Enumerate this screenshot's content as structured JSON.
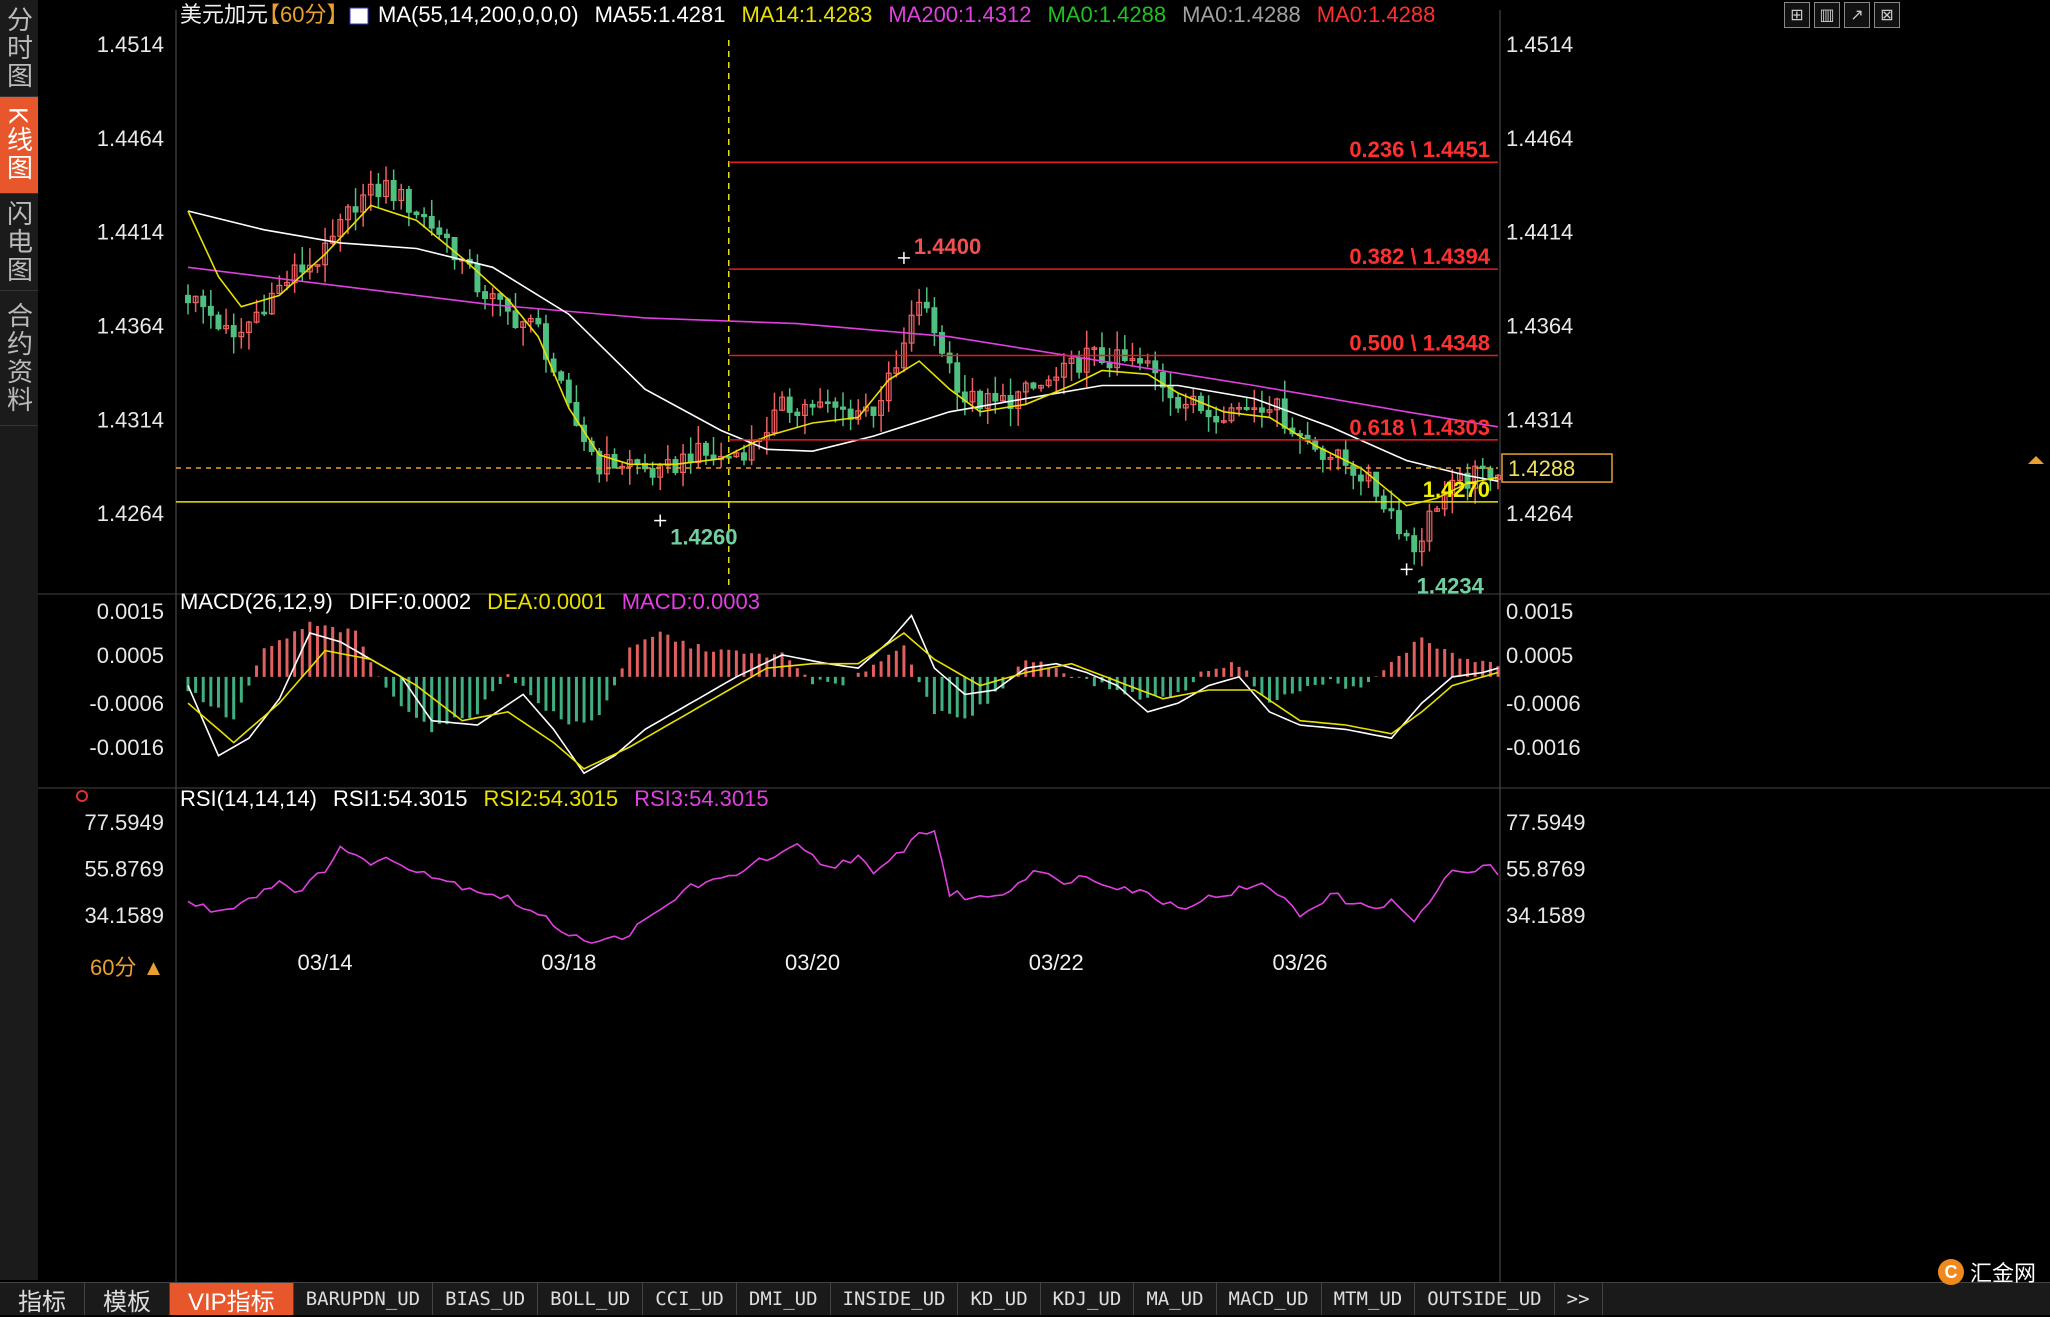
{
  "window": {
    "sidebar_tabs": [
      "分时图",
      "K线图",
      "闪电图",
      "合约资料"
    ],
    "active_sidebar_tab": 1,
    "period_label": "60分 ▲",
    "brand": "汇金网",
    "toolbar_icons": [
      "grid-icon",
      "layout-icon",
      "line-chart-icon",
      "close-icon"
    ]
  },
  "indicator_tabs": {
    "main": [
      "指标",
      "模板",
      "VIP指标"
    ],
    "active": 2,
    "list": [
      "BARUPDN_UD",
      "BIAS_UD",
      "BOLL_UD",
      "CCI_UD",
      "DMI_UD",
      "INSIDE_UD",
      "KD_UD",
      "KDJ_UD",
      "MA_UD",
      "MACD_UD",
      "MTM_UD",
      "OUTSIDE_UD",
      ">>"
    ]
  },
  "chart_data": [
    {
      "type": "candlestick",
      "title": "美元加元",
      "period": "【60分】",
      "legend": [
        {
          "text": "MA(55,14,200,0,0,0)",
          "color": "#ffffff"
        },
        {
          "text": "MA55:1.4281",
          "color": "#ffffff"
        },
        {
          "text": "MA14:1.4283",
          "color": "#e8e000"
        },
        {
          "text": "MA200:1.4312",
          "color": "#e040e0"
        },
        {
          "text": "MA0:1.4288",
          "color": "#20c020"
        },
        {
          "text": "MA0:1.4288",
          "color": "#a0a0a0"
        },
        {
          "text": "MA0:1.4288",
          "color": "#ff3030"
        }
      ],
      "y_ticks": [
        "1.4514",
        "1.4464",
        "1.4414",
        "1.4364",
        "1.4314",
        "1.4264"
      ],
      "ylim": [
        1.4223,
        1.453
      ],
      "x_ticks": [
        {
          "label": "03/14",
          "x": 18
        },
        {
          "label": "03/18",
          "x": 50
        },
        {
          "label": "03/20",
          "x": 82
        },
        {
          "label": "03/22",
          "x": 114
        },
        {
          "label": "03/26",
          "x": 146
        }
      ],
      "x_range": [
        0,
        172
      ],
      "close_anchors": [
        [
          0,
          1.438
        ],
        [
          3,
          1.437
        ],
        [
          6,
          1.4355
        ],
        [
          10,
          1.4376
        ],
        [
          14,
          1.4392
        ],
        [
          18,
          1.4402
        ],
        [
          22,
          1.443
        ],
        [
          26,
          1.4438
        ],
        [
          30,
          1.4425
        ],
        [
          34,
          1.441
        ],
        [
          38,
          1.4385
        ],
        [
          42,
          1.437
        ],
        [
          46,
          1.4362
        ],
        [
          50,
          1.4318
        ],
        [
          54,
          1.429
        ],
        [
          58,
          1.4291
        ],
        [
          62,
          1.4284
        ],
        [
          66,
          1.4296
        ],
        [
          70,
          1.4293
        ],
        [
          74,
          1.43
        ],
        [
          78,
          1.432
        ],
        [
          82,
          1.4322
        ],
        [
          86,
          1.4318
        ],
        [
          90,
          1.432
        ],
        [
          93,
          1.434
        ],
        [
          96,
          1.4378
        ],
        [
          99,
          1.4352
        ],
        [
          102,
          1.4325
        ],
        [
          106,
          1.4322
        ],
        [
          110,
          1.4328
        ],
        [
          114,
          1.4335
        ],
        [
          118,
          1.4348
        ],
        [
          122,
          1.4345
        ],
        [
          126,
          1.4342
        ],
        [
          130,
          1.4325
        ],
        [
          134,
          1.4318
        ],
        [
          138,
          1.432
        ],
        [
          142,
          1.4324
        ],
        [
          146,
          1.4305
        ],
        [
          150,
          1.4295
        ],
        [
          154,
          1.4285
        ],
        [
          158,
          1.4265
        ],
        [
          161,
          1.4245
        ],
        [
          164,
          1.427
        ],
        [
          167,
          1.428
        ],
        [
          170,
          1.4285
        ],
        [
          172,
          1.4288
        ]
      ],
      "fib_levels": [
        {
          "label": "0.236 \\ 1.4451",
          "value": 1.4451
        },
        {
          "label": "0.382 \\ 1.4394",
          "value": 1.4394
        },
        {
          "label": "0.500 \\ 1.4348",
          "value": 1.4348
        },
        {
          "label": "0.618 \\ 1.4303",
          "value": 1.4303
        }
      ],
      "fib_start_x": 71,
      "support_line": {
        "label": "1.4270",
        "value": 1.427
      },
      "current_price": {
        "label": "1.4288",
        "value": 1.4288
      },
      "vertical_marker_x": 71,
      "extreme_labels": [
        {
          "label": "1.4400",
          "x": 94,
          "value": 1.44,
          "type": "high"
        },
        {
          "label": "1.4260",
          "x": 62,
          "value": 1.426,
          "type": "low"
        },
        {
          "label": "1.4234",
          "x": 160,
          "value": 1.4234,
          "type": "low"
        }
      ],
      "ma_lines": [
        {
          "name": "MA200",
          "color": "#e040e0",
          "points": [
            [
              0,
              1.4395
            ],
            [
              20,
              1.4385
            ],
            [
              40,
              1.4375
            ],
            [
              60,
              1.4368
            ],
            [
              80,
              1.4365
            ],
            [
              100,
              1.4358
            ],
            [
              120,
              1.4345
            ],
            [
              140,
              1.4332
            ],
            [
              160,
              1.4318
            ],
            [
              172,
              1.431
            ]
          ]
        },
        {
          "name": "MA55",
          "color": "#ffffff",
          "points": [
            [
              0,
              1.4425
            ],
            [
              10,
              1.4415
            ],
            [
              20,
              1.4408
            ],
            [
              30,
              1.4405
            ],
            [
              40,
              1.4395
            ],
            [
              50,
              1.437
            ],
            [
              60,
              1.433
            ],
            [
              70,
              1.4308
            ],
            [
              76,
              1.4298
            ],
            [
              82,
              1.4297
            ],
            [
              90,
              1.4305
            ],
            [
              100,
              1.4318
            ],
            [
              110,
              1.4325
            ],
            [
              120,
              1.4332
            ],
            [
              130,
              1.4332
            ],
            [
              140,
              1.4325
            ],
            [
              150,
              1.431
            ],
            [
              160,
              1.4292
            ],
            [
              168,
              1.4284
            ],
            [
              172,
              1.4281
            ]
          ]
        },
        {
          "name": "MA14",
          "color": "#e8e000",
          "points": [
            [
              0,
              1.4425
            ],
            [
              4,
              1.439
            ],
            [
              7,
              1.4374
            ],
            [
              12,
              1.438
            ],
            [
              18,
              1.4402
            ],
            [
              24,
              1.4428
            ],
            [
              30,
              1.442
            ],
            [
              36,
              1.44
            ],
            [
              42,
              1.4378
            ],
            [
              46,
              1.4358
            ],
            [
              50,
              1.432
            ],
            [
              54,
              1.4295
            ],
            [
              58,
              1.429
            ],
            [
              64,
              1.429
            ],
            [
              70,
              1.4293
            ],
            [
              76,
              1.4305
            ],
            [
              82,
              1.4312
            ],
            [
              88,
              1.4315
            ],
            [
              92,
              1.4335
            ],
            [
              96,
              1.4345
            ],
            [
              100,
              1.433
            ],
            [
              104,
              1.4318
            ],
            [
              110,
              1.4322
            ],
            [
              116,
              1.4332
            ],
            [
              120,
              1.434
            ],
            [
              126,
              1.4338
            ],
            [
              130,
              1.4328
            ],
            [
              136,
              1.4318
            ],
            [
              142,
              1.4315
            ],
            [
              148,
              1.43
            ],
            [
              154,
              1.4288
            ],
            [
              160,
              1.4268
            ],
            [
              164,
              1.4272
            ],
            [
              168,
              1.428
            ],
            [
              172,
              1.4283
            ]
          ]
        }
      ]
    },
    {
      "type": "bar+line",
      "title": "MACD(26,12,9)",
      "legend": [
        {
          "text": "MACD(26,12,9)",
          "color": "#ffffff"
        },
        {
          "text": "DIFF:0.0002",
          "color": "#ffffff"
        },
        {
          "text": "DEA:0.0001",
          "color": "#e8e000"
        },
        {
          "text": "MACD:0.0003",
          "color": "#e040e0"
        }
      ],
      "y_ticks": [
        "0.0015",
        "0.0005",
        "-0.0006",
        "-0.0016"
      ],
      "ylim": [
        -0.0024,
        0.0018
      ],
      "hist_anchors": [
        [
          0,
          -0.0003
        ],
        [
          6,
          -0.001
        ],
        [
          10,
          0.0006
        ],
        [
          16,
          0.0012
        ],
        [
          22,
          0.001
        ],
        [
          26,
          -0.0003
        ],
        [
          32,
          -0.0012
        ],
        [
          38,
          -0.0008
        ],
        [
          42,
          0.0001
        ],
        [
          46,
          -0.0006
        ],
        [
          50,
          -0.0011
        ],
        [
          54,
          -0.0009
        ],
        [
          58,
          0.0006
        ],
        [
          62,
          0.001
        ],
        [
          66,
          0.0007
        ],
        [
          70,
          0.0006
        ],
        [
          74,
          0.0005
        ],
        [
          78,
          0.0005
        ],
        [
          82,
          -0.0001
        ],
        [
          86,
          -0.0002
        ],
        [
          90,
          0.0003
        ],
        [
          94,
          0.0007
        ],
        [
          98,
          -0.0008
        ],
        [
          102,
          -0.001
        ],
        [
          106,
          -0.0004
        ],
        [
          110,
          0.0004
        ],
        [
          114,
          0.0002
        ],
        [
          118,
          -0.0001
        ],
        [
          122,
          -0.0003
        ],
        [
          126,
          -0.0005
        ],
        [
          130,
          -0.0004
        ],
        [
          134,
          0.0002
        ],
        [
          138,
          0.0003
        ],
        [
          142,
          -0.0006
        ],
        [
          146,
          -0.0003
        ],
        [
          150,
          -0.0001
        ],
        [
          154,
          -0.0003
        ],
        [
          158,
          0.0003
        ],
        [
          162,
          0.0009
        ],
        [
          166,
          0.0005
        ],
        [
          170,
          0.0003
        ],
        [
          172,
          0.0003
        ]
      ],
      "diff_anchors": [
        [
          0,
          -0.0002
        ],
        [
          4,
          -0.0018
        ],
        [
          8,
          -0.0014
        ],
        [
          12,
          -0.0005
        ],
        [
          16,
          0.001
        ],
        [
          20,
          0.0008
        ],
        [
          24,
          0.0004
        ],
        [
          28,
          0.0
        ],
        [
          32,
          -0.001
        ],
        [
          38,
          -0.0011
        ],
        [
          44,
          -0.0004
        ],
        [
          48,
          -0.0012
        ],
        [
          52,
          -0.0022
        ],
        [
          56,
          -0.0018
        ],
        [
          60,
          -0.0012
        ],
        [
          66,
          -0.0006
        ],
        [
          72,
          0.0
        ],
        [
          78,
          0.0005
        ],
        [
          84,
          0.0003
        ],
        [
          88,
          0.0002
        ],
        [
          92,
          0.0008
        ],
        [
          95,
          0.0014
        ],
        [
          98,
          0.0002
        ],
        [
          102,
          -0.0004
        ],
        [
          106,
          -0.0003
        ],
        [
          110,
          0.0002
        ],
        [
          114,
          0.0003
        ],
        [
          118,
          0.0001
        ],
        [
          122,
          -0.0002
        ],
        [
          126,
          -0.0008
        ],
        [
          130,
          -0.0006
        ],
        [
          134,
          -0.0002
        ],
        [
          138,
          0.0
        ],
        [
          142,
          -0.0008
        ],
        [
          146,
          -0.0011
        ],
        [
          152,
          -0.0012
        ],
        [
          158,
          -0.0014
        ],
        [
          162,
          -0.0006
        ],
        [
          166,
          0.0
        ],
        [
          170,
          0.0001
        ],
        [
          172,
          0.0002
        ]
      ],
      "dea_anchors": [
        [
          0,
          -0.0006
        ],
        [
          6,
          -0.0015
        ],
        [
          12,
          -0.0006
        ],
        [
          18,
          0.0006
        ],
        [
          24,
          0.0004
        ],
        [
          30,
          -0.0002
        ],
        [
          36,
          -0.001
        ],
        [
          42,
          -0.0008
        ],
        [
          48,
          -0.0015
        ],
        [
          52,
          -0.0021
        ],
        [
          58,
          -0.0016
        ],
        [
          64,
          -0.001
        ],
        [
          70,
          -0.0004
        ],
        [
          76,
          0.0002
        ],
        [
          82,
          0.0003
        ],
        [
          88,
          0.0003
        ],
        [
          94,
          0.001
        ],
        [
          98,
          0.0004
        ],
        [
          104,
          -0.0002
        ],
        [
          110,
          0.0001
        ],
        [
          116,
          0.0003
        ],
        [
          122,
          -0.0001
        ],
        [
          128,
          -0.0005
        ],
        [
          134,
          -0.0003
        ],
        [
          140,
          -0.0003
        ],
        [
          146,
          -0.001
        ],
        [
          152,
          -0.0011
        ],
        [
          158,
          -0.0013
        ],
        [
          162,
          -0.0008
        ],
        [
          166,
          -0.0002
        ],
        [
          172,
          0.0001
        ]
      ]
    },
    {
      "type": "line",
      "title": "RSI(14,14,14)",
      "legend": [
        {
          "text": "RSI(14,14,14)",
          "color": "#ffffff"
        },
        {
          "text": "RSI1:54.3015",
          "color": "#ffffff"
        },
        {
          "text": "RSI2:54.3015",
          "color": "#e8e000"
        },
        {
          "text": "RSI3:54.3015",
          "color": "#e040e0"
        }
      ],
      "y_ticks": [
        "77.5949",
        "55.8769",
        "34.1589"
      ],
      "ylim": [
        18,
        84
      ],
      "rsi_anchors": [
        [
          0,
          40
        ],
        [
          4,
          36
        ],
        [
          8,
          42
        ],
        [
          12,
          50
        ],
        [
          15,
          45
        ],
        [
          18,
          56
        ],
        [
          20,
          66
        ],
        [
          23,
          59
        ],
        [
          26,
          60
        ],
        [
          30,
          56
        ],
        [
          34,
          50
        ],
        [
          38,
          46
        ],
        [
          42,
          42
        ],
        [
          46,
          34
        ],
        [
          50,
          26
        ],
        [
          54,
          21
        ],
        [
          58,
          26
        ],
        [
          62,
          36
        ],
        [
          66,
          48
        ],
        [
          70,
          50
        ],
        [
          74,
          58
        ],
        [
          78,
          62
        ],
        [
          80,
          66
        ],
        [
          84,
          56
        ],
        [
          88,
          62
        ],
        [
          90,
          52
        ],
        [
          93,
          62
        ],
        [
          96,
          72
        ],
        [
          98,
          74
        ],
        [
          100,
          44
        ],
        [
          104,
          42
        ],
        [
          108,
          46
        ],
        [
          111,
          56
        ],
        [
          114,
          50
        ],
        [
          118,
          52
        ],
        [
          122,
          48
        ],
        [
          126,
          44
        ],
        [
          130,
          38
        ],
        [
          134,
          42
        ],
        [
          138,
          46
        ],
        [
          142,
          48
        ],
        [
          146,
          34
        ],
        [
          150,
          44
        ],
        [
          154,
          38
        ],
        [
          158,
          40
        ],
        [
          161,
          32
        ],
        [
          164,
          44
        ],
        [
          166,
          56
        ],
        [
          168,
          52
        ],
        [
          170,
          58
        ],
        [
          172,
          54
        ]
      ]
    }
  ]
}
